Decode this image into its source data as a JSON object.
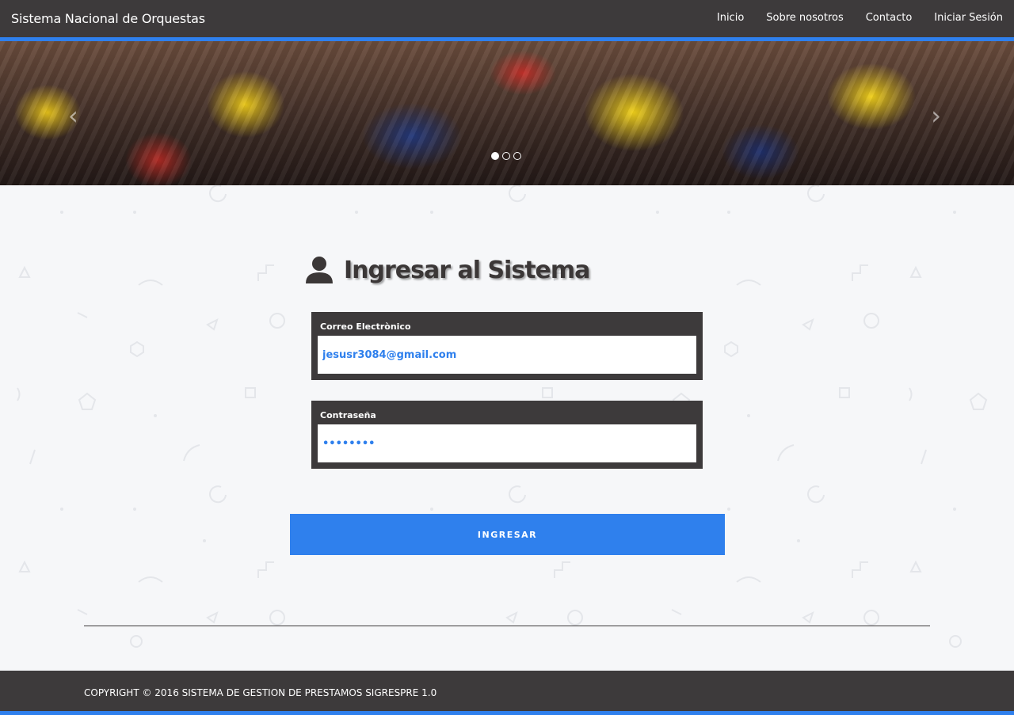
{
  "navbar": {
    "brand": "Sistema Nacional de Orquestas",
    "links": [
      "Inicio",
      "Sobre nosotros",
      "Contacto",
      "Iniciar Sesión"
    ]
  },
  "carousel": {
    "prev_glyph": "‹",
    "next_glyph": "›",
    "active_slide": 1,
    "slide_count": 3
  },
  "login": {
    "title": "Ingresar al Sistema",
    "icon": "user-icon",
    "email_label": "Correo Electrònico",
    "email_value": "jesusr3084@gmail.com",
    "password_label": "Contraseña",
    "password_value": "••••••••",
    "submit_label": "INGRESAR"
  },
  "footer": {
    "copyright": "COPYRIGHT © 2016 SISTEMA DE GESTION DE PRESTAMOS SIGRESPRE 1.0"
  },
  "colors": {
    "navbar": "#3d3a3b",
    "accent": "#2f80ed",
    "page_background": "#f6f7f9"
  }
}
